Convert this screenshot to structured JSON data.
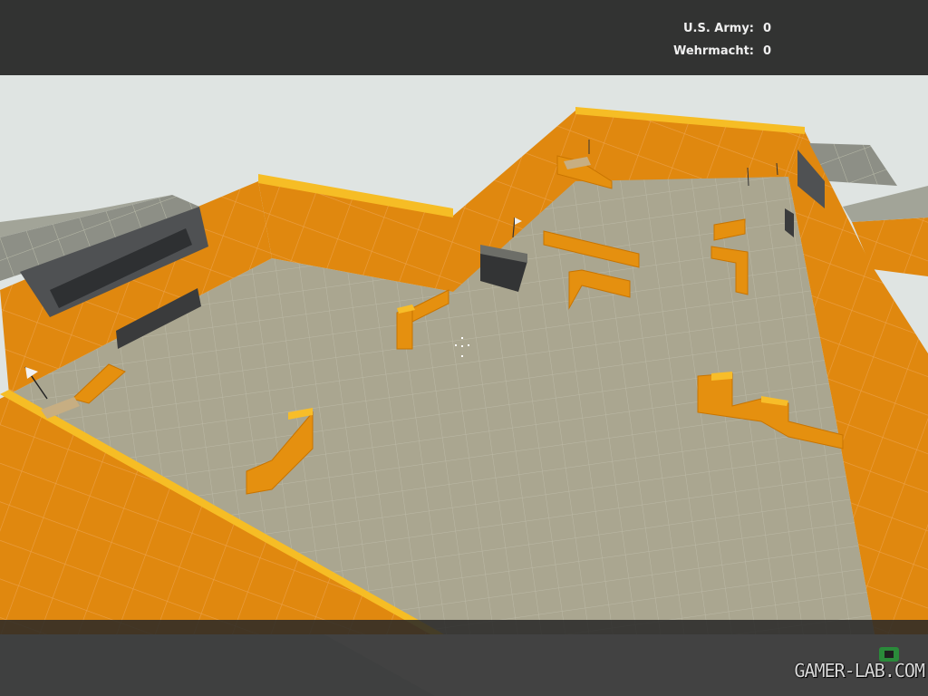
{
  "scoreboard": {
    "teams": [
      {
        "name": "U.S. Army:",
        "score": "0"
      },
      {
        "name": "Wehrmacht:",
        "score": "0"
      }
    ]
  },
  "watermark": "GAMER-LAB.COM",
  "colors": {
    "wall_orange": "#e08a12",
    "wall_top": "#f5b51c",
    "floor": "#a9a58e",
    "sky": "#dfe4e2",
    "hud": "#2c2c2c"
  },
  "icons": [
    "crosshair-icon",
    "flag-icon",
    "gamer-lab-logo-icon"
  ]
}
